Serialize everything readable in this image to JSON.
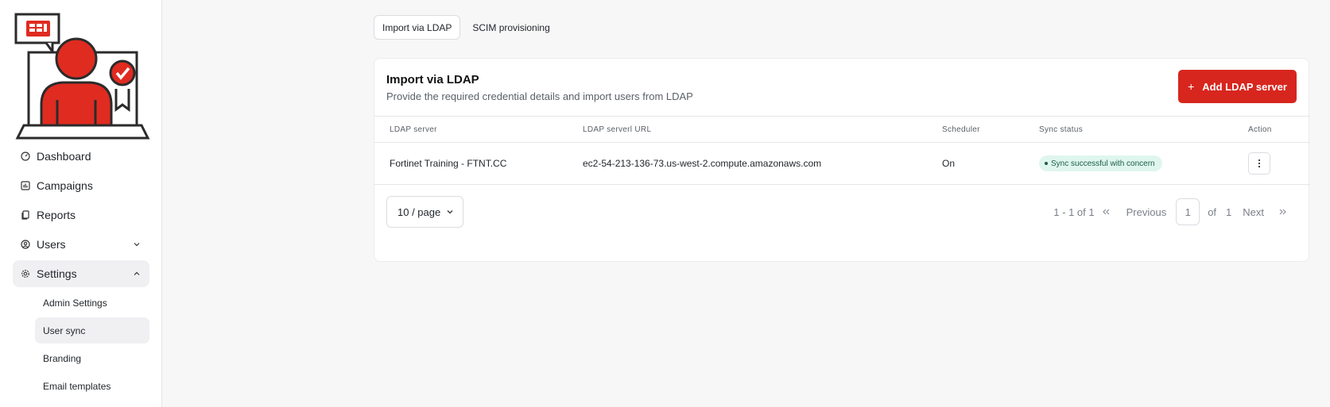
{
  "sidebar": {
    "items": [
      {
        "label": "Dashboard",
        "icon": "gauge-icon"
      },
      {
        "label": "Campaigns",
        "icon": "chart-icon"
      },
      {
        "label": "Reports",
        "icon": "document-icon"
      },
      {
        "label": "Users",
        "icon": "user-circle-icon"
      },
      {
        "label": "Settings",
        "icon": "gear-icon"
      }
    ],
    "settings_sub": [
      {
        "label": "Admin Settings"
      },
      {
        "label": "User sync"
      },
      {
        "label": "Branding"
      },
      {
        "label": "Email templates"
      }
    ]
  },
  "tabs": [
    {
      "label": "Import via LDAP"
    },
    {
      "label": "SCIM provisioning"
    }
  ],
  "card": {
    "title": "Import via LDAP",
    "subtitle": "Provide the required credential details and import users from LDAP",
    "add_button_label": "Add LDAP server"
  },
  "table": {
    "columns": [
      "LDAP server",
      "LDAP serverl URL",
      "Scheduler",
      "Sync status",
      "Action"
    ],
    "rows": [
      {
        "server": "Fortinet Training - FTNT.CC",
        "url": "ec2-54-213-136-73.us-west-2.compute.amazonaws.com",
        "scheduler": "On",
        "status": "Sync successful with concern"
      }
    ]
  },
  "pagination": {
    "page_size": "10 / page",
    "range": "1 - 1 of 1",
    "previous": "Previous",
    "current_page": "1",
    "of": "of",
    "total_pages": "1",
    "next": "Next"
  },
  "colors": {
    "accent": "#d7261e",
    "status_bg": "#dff6ee",
    "status_text": "#1c5e47"
  }
}
